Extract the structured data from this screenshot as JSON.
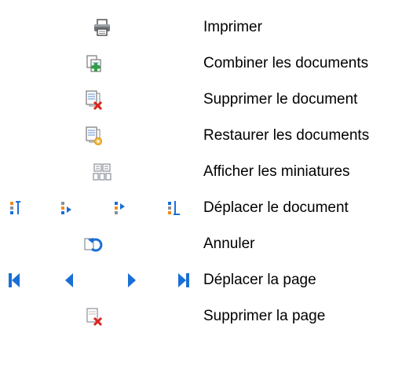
{
  "legend": {
    "items": [
      {
        "icon": "printer-icon",
        "label": "Imprimer"
      },
      {
        "icon": "combine-documents-icon",
        "label": "Combiner les documents"
      },
      {
        "icon": "delete-document-icon",
        "label": "Supprimer le document"
      },
      {
        "icon": "restore-documents-icon",
        "label": "Restaurer les documents"
      },
      {
        "icon": "thumbnails-icon",
        "label": "Afficher les miniatures"
      },
      {
        "icon": "move-document-icons",
        "label": "Déplacer le document"
      },
      {
        "icon": "undo-icon",
        "label": "Annuler"
      },
      {
        "icon": "move-page-icons",
        "label": "Déplacer la page"
      },
      {
        "icon": "delete-page-icon",
        "label": "Supprimer la page"
      }
    ]
  },
  "colors": {
    "blue": "#1a6fd6",
    "orange": "#f08a1e",
    "red": "#d9261c",
    "green": "#2ea043",
    "gray": "#8a8f99"
  }
}
